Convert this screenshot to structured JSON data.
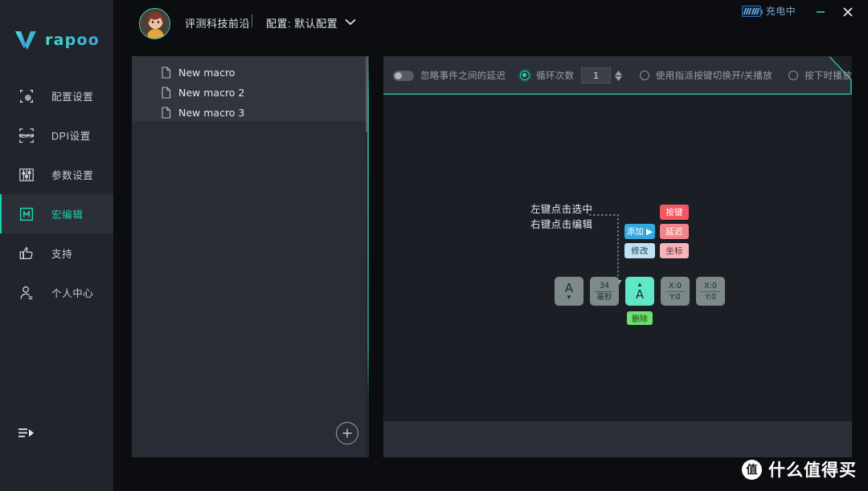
{
  "app": {
    "brand": "rapoo",
    "logo_accent": "#3fe0c8"
  },
  "titlebar": {
    "battery_label": "充电中",
    "minimize_label": "–",
    "close_label": "✕"
  },
  "header": {
    "user_name": "评测科技前沿",
    "separator": "|",
    "config_label": "配置: 默认配置"
  },
  "sidebar": {
    "items": [
      {
        "label": "配置设置",
        "icon": "config-icon",
        "active": false
      },
      {
        "label": "DPI设置",
        "icon": "dpi-icon",
        "active": false
      },
      {
        "label": "参数设置",
        "icon": "sliders-icon",
        "active": false
      },
      {
        "label": "宏编辑",
        "icon": "macro-icon",
        "active": true
      },
      {
        "label": "支持",
        "icon": "thumbs-up-icon",
        "active": false
      },
      {
        "label": "个人中心",
        "icon": "user-icon",
        "active": false
      }
    ],
    "collapse_label": "collapse"
  },
  "macro_list": {
    "items": [
      {
        "name": "New macro"
      },
      {
        "name": "New macro 2"
      },
      {
        "name": "New macro 3"
      }
    ],
    "add_label": "+"
  },
  "toolbar": {
    "ignore_delay_label": "忽略事件之间的延迟",
    "ignore_delay_enabled": false,
    "loop_count_label": "循环次数",
    "loop_count_value": "1",
    "loop_count_selected": true,
    "toggle_playback_label": "使用指派按键切换开/关播放",
    "toggle_playback_selected": false,
    "hold_to_play_label": "按下时播放",
    "hold_to_play_selected": false
  },
  "diagram": {
    "hint_line1": "左键点击选中",
    "hint_line2": "右键点击编辑",
    "actions": [
      {
        "label": "添加 ▶",
        "color": "#33a9e0"
      },
      {
        "label": "修改",
        "color": "#bfe2f5"
      }
    ],
    "types": [
      {
        "label": "按键",
        "color": "#f3575f"
      },
      {
        "label": "延迟",
        "color": "#f3838b"
      },
      {
        "label": "坐标",
        "color": "#f8b4b9"
      }
    ],
    "delete_label": "删除"
  },
  "events": [
    {
      "kind": "key-down",
      "top": "",
      "letter": "A",
      "arrow": "▼",
      "bottom": "",
      "selected": false
    },
    {
      "kind": "delay",
      "top": "34",
      "letter": "",
      "arrow": "",
      "bottom": "毫秒",
      "selected": false
    },
    {
      "kind": "key-up",
      "top": "",
      "letter": "A",
      "arrow": "▲",
      "bottom": "",
      "selected": true
    },
    {
      "kind": "coord",
      "top": "X:0",
      "letter": "",
      "arrow": "",
      "bottom": "Y:0",
      "selected": false
    },
    {
      "kind": "coord",
      "top": "X:0",
      "letter": "",
      "arrow": "",
      "bottom": "Y:0",
      "selected": false
    }
  ],
  "watermark": {
    "mark": "值",
    "text": "什么值得买"
  }
}
